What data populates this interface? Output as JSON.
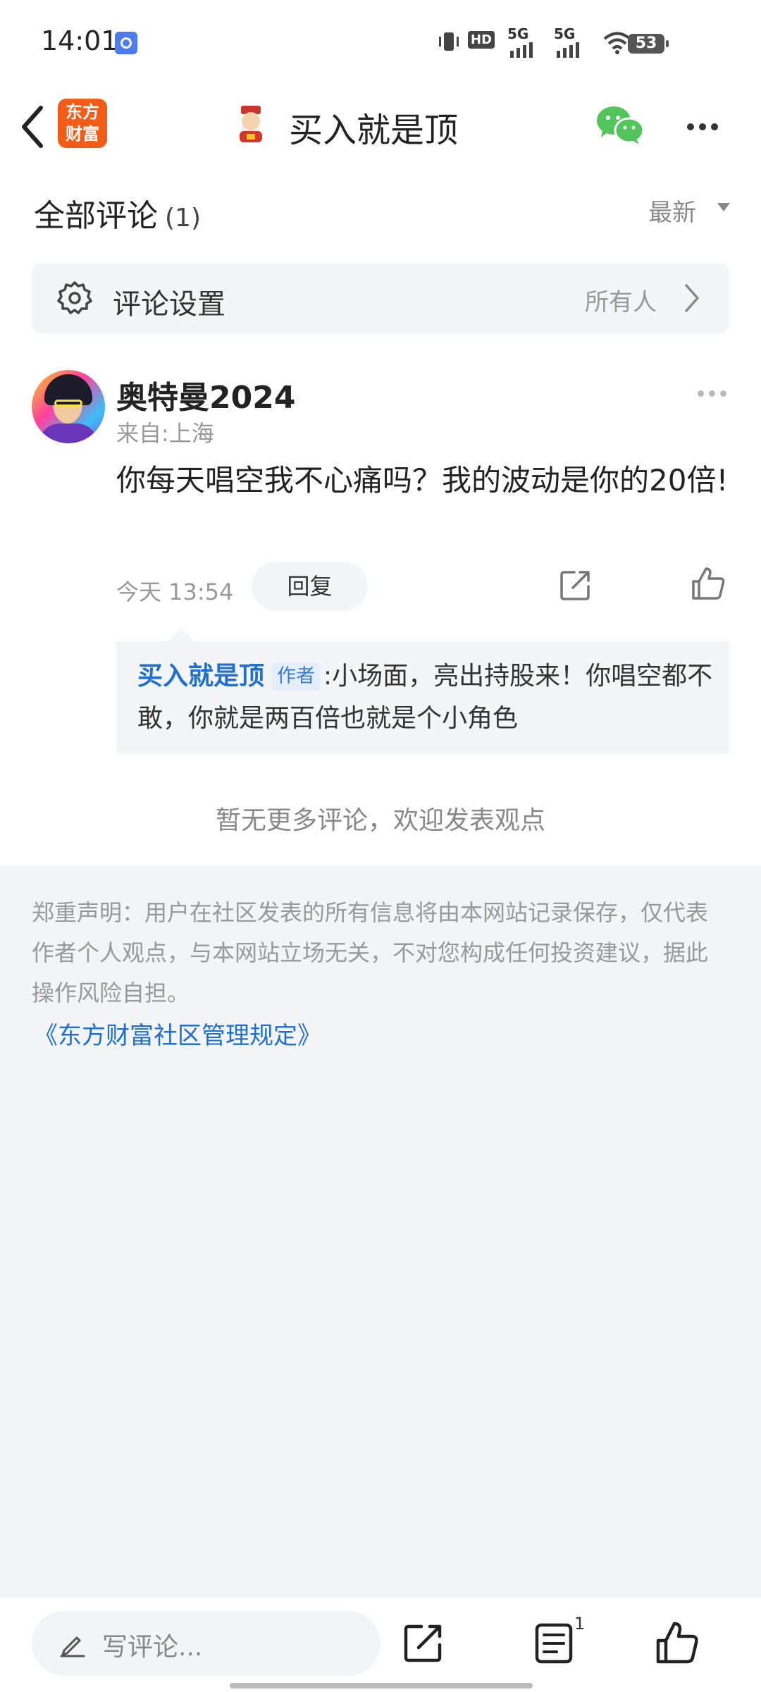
{
  "status_bar": {
    "time": "14:01",
    "hd_label": "HD",
    "net1": "5G",
    "net2": "5G",
    "battery": "53"
  },
  "header": {
    "brand_logo_line1": "东方",
    "brand_logo_line2": "财富",
    "title": "买入就是顶",
    "icons": [
      "back-icon",
      "mascot-icon",
      "wechat-icon",
      "more-icon"
    ]
  },
  "comments_section": {
    "title": "全部评论",
    "count": "(1)",
    "sort_label": "最新"
  },
  "settings": {
    "label": "评论设置",
    "value": "所有人"
  },
  "comment": {
    "username": "奥特曼2024",
    "location": "来自:上海",
    "text": "你每天唱空我不心痛吗？我的波动是你的20倍!",
    "time": "今天 13:54",
    "reply_button": "回复",
    "reply": {
      "author": "买入就是顶",
      "badge": "作者",
      "text": ":小场面，亮出持股来！你唱空都不敢，你就是两百倍也就是个小角色"
    }
  },
  "no_more": "暂无更多评论，欢迎发表观点",
  "disclaimer": {
    "text": "郑重声明：用户在社区发表的所有信息将由本网站记录保存，仅代表作者个人观点，与本网站立场无关，不对您构成任何投资建议，据此操作风险自担。",
    "rules_link": "《东方财富社区管理规定》"
  },
  "bottom_bar": {
    "write_placeholder": "写评论...",
    "comment_count": "1"
  },
  "colors": {
    "brand": "#f45b16",
    "link": "#1f6fd0",
    "badge_bg": "#e5effb",
    "wechat": "#52c55a"
  }
}
